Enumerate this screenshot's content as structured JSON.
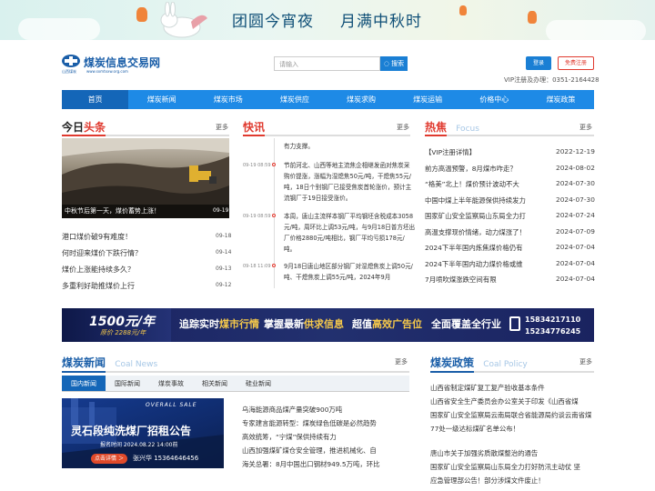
{
  "banner": {
    "title_left": "团圆今宵夜",
    "title_right": "月满中秋时"
  },
  "header": {
    "logo_text": "煤炭信息交易网",
    "logo_sub": "山西煤炭",
    "logo_url": "www.sxmtxxw.org.com",
    "search_placeholder": "请输入",
    "search_label": "◌ 搜索",
    "login_label": "登录",
    "register_label": "免费注册",
    "vip_line": "VIP注册及办理：0351-2164428"
  },
  "nav": {
    "items": [
      "首页",
      "煤炭新闻",
      "煤炭市场",
      "煤炭供应",
      "煤炭求购",
      "煤炭运输",
      "价格中心",
      "煤炭政策"
    ]
  },
  "today": {
    "title_a": "今日",
    "title_b": "头条",
    "more": "更多",
    "photo_caption": "中秋节后第一天，煤价蓄势上涨！",
    "photo_date": "09-19",
    "items": [
      {
        "title": "港口煤价破9有难度！",
        "date": "09-18"
      },
      {
        "title": "何时迎来煤价下跌行情？",
        "date": "09-14"
      },
      {
        "title": "煤价上涨能持续多久？",
        "date": "09-13"
      },
      {
        "title": "多重利好助推煤价上行",
        "date": "09-12"
      }
    ]
  },
  "flash": {
    "title": "快讯",
    "more": "更多",
    "top_text": "有力支撑。",
    "items": [
      {
        "time": "09-19 08:59",
        "text": "节前河北、山西等地主流焦企相继发函对焦炭采购价提涨，涨幅为湿熄焦50元/吨，干熄焦55元/吨，18日个别钢厂已接受焦炭首轮涨价，预计主流钢厂于19日接受涨价。"
      },
      {
        "time": "09-19 08:59",
        "text": "本周，唐山主流样本钢厂平均钢坯含税成本3058元/吨，周环比上调53元/吨，与9月18日普方坯出厂价格2880元/吨相比，钢厂平均亏损178元/吨。"
      },
      {
        "time": "09-18 11:09",
        "text": "9月18日唐山地区部分钢厂对湿熄焦炭上调50元/吨、干熄焦炭上调55元/吨，2024年9月"
      }
    ]
  },
  "focus": {
    "title": "热焦",
    "title_en": "Focus",
    "more": "更多",
    "items": [
      {
        "title": "【VIP注册详情】",
        "date": "2022-12-19"
      },
      {
        "title": "前方高温预警，8月煤市咋走？",
        "date": "2024-08-02"
      },
      {
        "title": "“格美”北上！煤价预计波动不大",
        "date": "2024-07-30"
      },
      {
        "title": "中国中煤上半年能源保供持续发力",
        "date": "2024-07-30"
      },
      {
        "title": "国家矿山安全监察局山东局全力打",
        "date": "2024-07-24"
      },
      {
        "title": "高温支撑现价情绪，动力煤涨了！",
        "date": "2024-07-09"
      },
      {
        "title": "2024下半年国内炼焦煤价格仍有",
        "date": "2024-07-04"
      },
      {
        "title": "2024下半年国内动力煤价格或维",
        "date": "2024-07-04"
      },
      {
        "title": "7月喷吹煤涨跌空间有限",
        "date": "2024-07-04"
      }
    ]
  },
  "ad": {
    "price": "1500元/年",
    "price_sub": "原价 2288元/年",
    "slogan_1a": "追踪实时",
    "slogan_1b": "煤市行情",
    "slogan_2a": "掌握最新",
    "slogan_2b": "供求信息",
    "slogan_3a": "超值",
    "slogan_3b": "高效广告位",
    "slogan_4": "全面覆盖全行业",
    "phone1": "15834217110",
    "phone2": "15234776245"
  },
  "news": {
    "title": "煤炭新闻",
    "title_en": "Coal News",
    "more": "更多",
    "tabs": [
      "国内新闻",
      "国际新闻",
      "煤炭事故",
      "相关新闻",
      "硅业新闻"
    ],
    "ad_overall": "OVERALL SALE",
    "ad_title": "灵石段纯洗煤厂招租公告",
    "ad_date": "报名时间 2024.08.22 14:00前",
    "ad_button": "点击详情 ＞",
    "ad_contact": "张兴华 15364646456",
    "items": [
      "乌海能源商品煤产量突破900万吨",
      "专家建言能源转型：煤炭绿色低碳是必然趋势",
      "高效统筹，“宁煤”保供持续有力",
      "山西加强煤矿煤仓安全管理，推进机械化、自",
      "海关总署：8月中国出口钢材949.5万吨，环比"
    ]
  },
  "policy": {
    "title": "煤炭政策",
    "title_en": "Coal Policy",
    "more": "更多",
    "items": [
      "山西省制定煤矿复工复产验收基本条件",
      "山西省安全生产委员会办公室关于印发《山西省煤",
      "国家矿山安全监察局云南局联合省能源局约谈云南省煤",
      "77处一级达标煤矿名单公布！",
      "",
      "唐山市关于加强劣质散煤整治的通告",
      "国家矿山安全监察局山东局全力打好防汛主动仗 坚",
      "应急管理部公告！部分涉煤文件废止！"
    ]
  }
}
